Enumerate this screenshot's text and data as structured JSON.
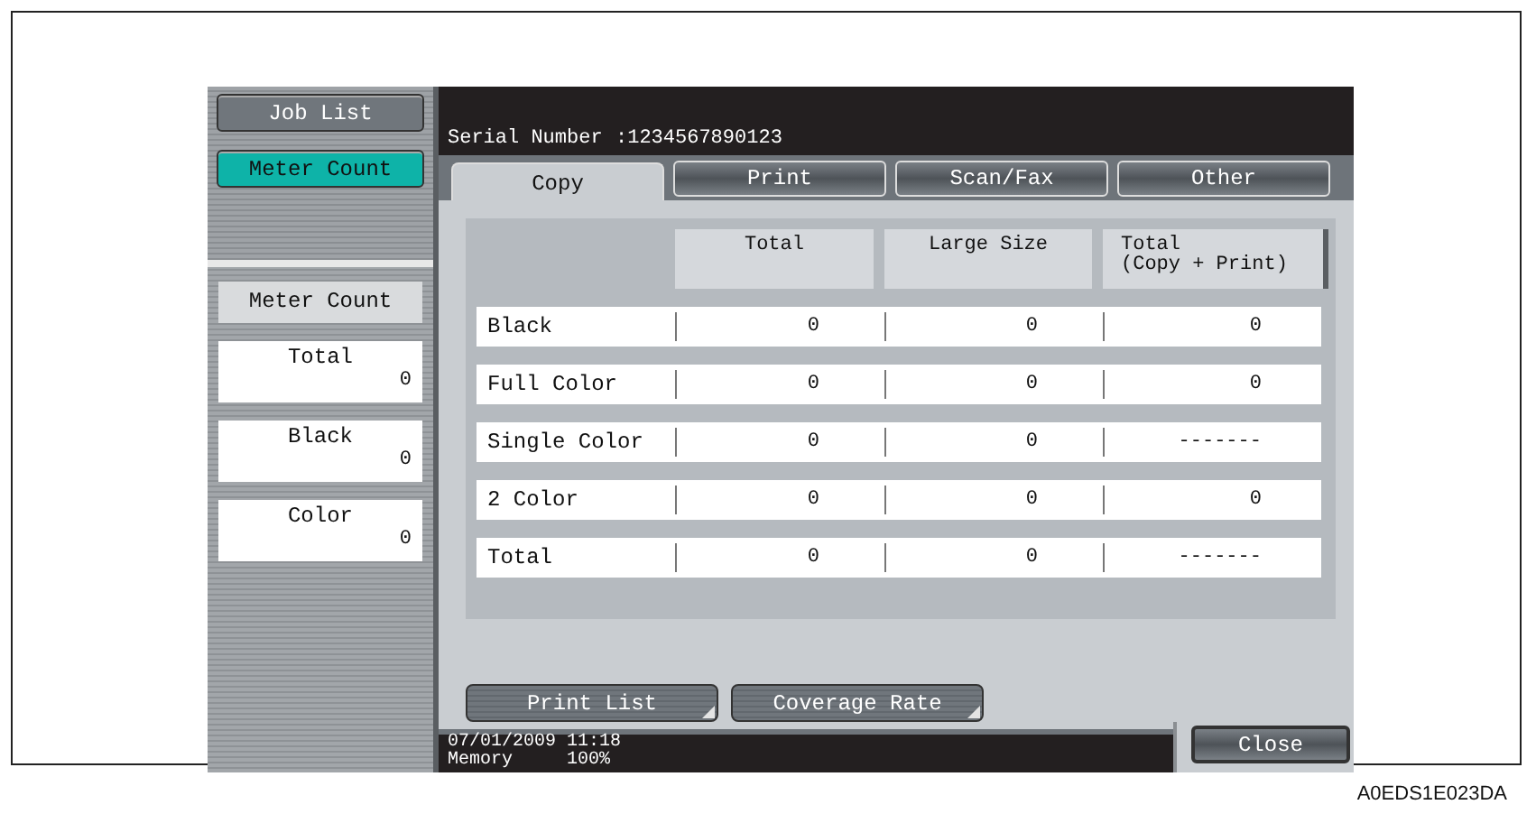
{
  "nav": [
    {
      "label": "Job List",
      "selected": false
    },
    {
      "label": "Meter Count",
      "selected": true
    }
  ],
  "summary": {
    "title": "Meter Count",
    "counters": [
      {
        "label": "Total",
        "value": "0"
      },
      {
        "label": "Black",
        "value": "0"
      },
      {
        "label": "Color",
        "value": "0"
      }
    ]
  },
  "serial": {
    "label": "Serial Number",
    "value": ":1234567890123"
  },
  "tabs": [
    {
      "label": "Copy",
      "selected": true
    },
    {
      "label": "Print",
      "selected": false
    },
    {
      "label": "Scan/Fax",
      "selected": false
    },
    {
      "label": "Other",
      "selected": false
    }
  ],
  "table": {
    "columns": [
      "Total",
      "Large Size",
      "Total\n(Copy + Print)"
    ],
    "rows": [
      {
        "label": "Black",
        "cells": [
          "0",
          "0",
          "0"
        ]
      },
      {
        "label": "Full Color",
        "cells": [
          "0",
          "0",
          "0"
        ]
      },
      {
        "label": "Single Color",
        "cells": [
          "0",
          "0",
          "-------"
        ]
      },
      {
        "label": "2 Color",
        "cells": [
          "0",
          "0",
          "0"
        ]
      },
      {
        "label": "Total",
        "cells": [
          "0",
          "0",
          "-------"
        ]
      }
    ]
  },
  "buttons": [
    "Print List",
    "Coverage Rate"
  ],
  "status": {
    "date": "07/01/2009",
    "time": "11:18",
    "memory_label": "Memory",
    "memory_value": "100%"
  },
  "close_button": "Close",
  "figure_code": "A0EDS1E023DA"
}
